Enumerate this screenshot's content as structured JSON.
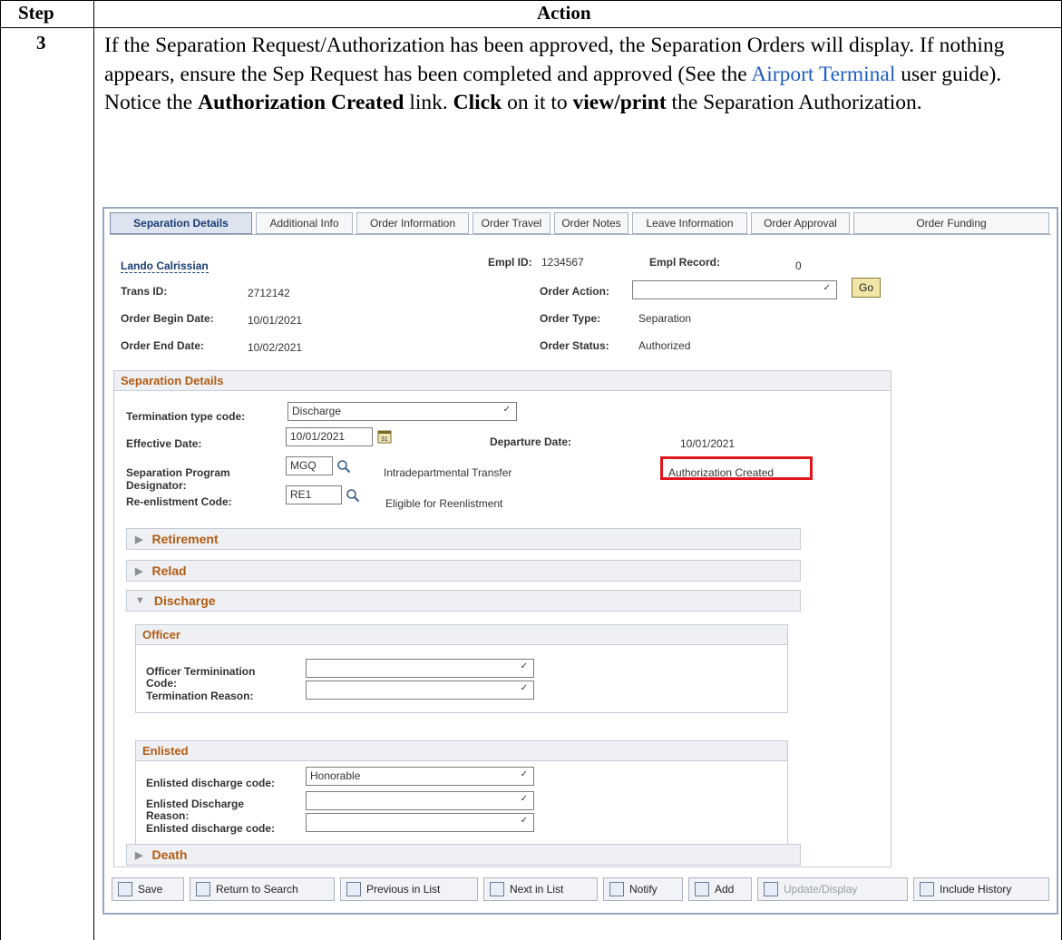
{
  "table": {
    "header_step": "Step",
    "header_action": "Action",
    "step_number": "3",
    "text_before_link": "If the Separation Request/Authorization has been approved, the Separation Orders will display.  If nothing appears, ensure the Sep Request has been completed and approved (See the ",
    "link_text": "Airport Terminal",
    "text_after_link": " user guide).  Notice the ",
    "bold_1": "Authorization Created",
    "text_mid_1": " link.  ",
    "bold_2": "Click",
    "text_mid_2": " on it to ",
    "bold_3": "view/print",
    "text_end": " the Separation Authorization."
  },
  "tabs": [
    {
      "label": "Separation Details",
      "active": true
    },
    {
      "label": "Additional Info"
    },
    {
      "label": "Order Information"
    },
    {
      "label": "Order Travel"
    },
    {
      "label": "Order Notes"
    },
    {
      "label": "Leave Information"
    },
    {
      "label": "Order Approval"
    },
    {
      "label": "Order Funding"
    }
  ],
  "header": {
    "name": "Lando Calrissian",
    "empl_id_label": "Empl ID:",
    "empl_id": "1234567",
    "empl_record_label": "Empl Record:",
    "empl_record": "0",
    "trans_id_label": "Trans ID:",
    "trans_id": "2712142",
    "order_action_label": "Order Action:",
    "order_action_value": "",
    "go_label": "Go",
    "order_begin_label": "Order Begin Date:",
    "order_begin": "10/01/2021",
    "order_type_label": "Order Type:",
    "order_type": "Separation",
    "order_end_label": "Order End Date:",
    "order_end": "10/02/2021",
    "order_status_label": "Order Status:",
    "order_status": "Authorized"
  },
  "separation": {
    "title": "Separation Details",
    "term_type_label": "Termination type code:",
    "term_type_value": "Discharge",
    "effective_date_label": "Effective Date:",
    "effective_date": "10/01/2021",
    "departure_date_label": "Departure Date:",
    "departure_date": "10/01/2021",
    "sep_program_label": "Separation Program",
    "sep_program_label2": "Designator:",
    "sep_program_code": "MGQ",
    "sep_program_desc": "Intradepartmental Transfer",
    "auth_link": "Authorization Created",
    "reenlist_label": "Re-enlistment Code:",
    "reenlist_code": "RE1",
    "reenlist_desc": "Eligible for Reenlistment"
  },
  "sections": {
    "retirement": "Retirement",
    "relad": "Relad",
    "discharge": "Discharge",
    "death": "Death"
  },
  "officer": {
    "title": "Officer",
    "term_code_label": "Officer Terminination",
    "term_code_label2": "Code:",
    "term_code_value": "",
    "term_reason_label": "Termination Reason:",
    "term_reason_value": ""
  },
  "enlisted": {
    "title": "Enlisted",
    "discharge_code_label": "Enlisted discharge code:",
    "discharge_code_value": "Honorable",
    "discharge_reason_label": "Enlisted Discharge",
    "discharge_reason_label2": "Reason:",
    "discharge_reason_value": "",
    "discharge_code2_label": "Enlisted discharge code:",
    "discharge_code2_value": ""
  },
  "toolbar": {
    "save": "Save",
    "return_to_search": "Return to Search",
    "previous_in_list": "Previous in List",
    "next_in_list": "Next in List",
    "notify": "Notify",
    "add": "Add",
    "update_display": "Update/Display",
    "include_history": "Include History"
  },
  "colors": {
    "highlight_box": "#e0161d",
    "section_title": "#b35c14",
    "link": "#1a3c72",
    "doc_link": "#1f5ec4"
  },
  "icons": [
    "calendar-icon",
    "search-icon",
    "chevron-down-icon",
    "triangle-right-icon",
    "triangle-down-icon",
    "save-icon",
    "notify-icon",
    "add-icon"
  ]
}
